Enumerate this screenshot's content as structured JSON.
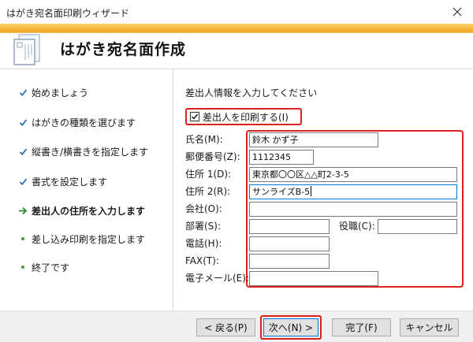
{
  "window": {
    "title": "はがき宛名面印刷ウィザード"
  },
  "header": {
    "heading": "はがき宛名面作成"
  },
  "steps": [
    {
      "label": "始めましょう",
      "state": "done"
    },
    {
      "label": "はがきの種類を選びます",
      "state": "done"
    },
    {
      "label": "縦書き/横書きを指定します",
      "state": "done"
    },
    {
      "label": "書式を設定します",
      "state": "done"
    },
    {
      "label": "差出人の住所を入力します",
      "state": "current"
    },
    {
      "label": "差し込み印刷を指定します",
      "state": "pending"
    },
    {
      "label": "終了です",
      "state": "pending"
    }
  ],
  "main": {
    "instruction": "差出人情報を入力してください",
    "print_sender": {
      "label": "差出人を印刷する(I)",
      "checked": true
    },
    "fields": {
      "name": {
        "label": "氏名(M):",
        "value": "鈴木 かず子"
      },
      "postal": {
        "label": "郵便番号(Z):",
        "value": "1112345"
      },
      "address1": {
        "label": "住所 1(D):",
        "value": "東京都〇〇区△△町2-3-5"
      },
      "address2": {
        "label": "住所 2(R):",
        "value": "サンライズB-5"
      },
      "company": {
        "label": "会社(O):",
        "value": ""
      },
      "department": {
        "label": "部署(S):",
        "value": ""
      },
      "position": {
        "label": "役職(C):",
        "value": ""
      },
      "phone": {
        "label": "電話(H):",
        "value": ""
      },
      "fax": {
        "label": "FAX(T):",
        "value": ""
      },
      "email": {
        "label": "電子メール(E):",
        "value": ""
      }
    }
  },
  "footer": {
    "back": "< 戻る(P)",
    "next": "次へ(N) >",
    "finish": "完了(F)",
    "cancel": "キャンセル"
  },
  "colors": {
    "accent": "#f4a21c",
    "highlight": "#e02020",
    "check": "#2b6cb0",
    "bullet": "#4a9a3b"
  },
  "icons": {
    "done": "checkmark-icon",
    "current": "arrow-right-icon",
    "pending": "bullet-icon"
  }
}
